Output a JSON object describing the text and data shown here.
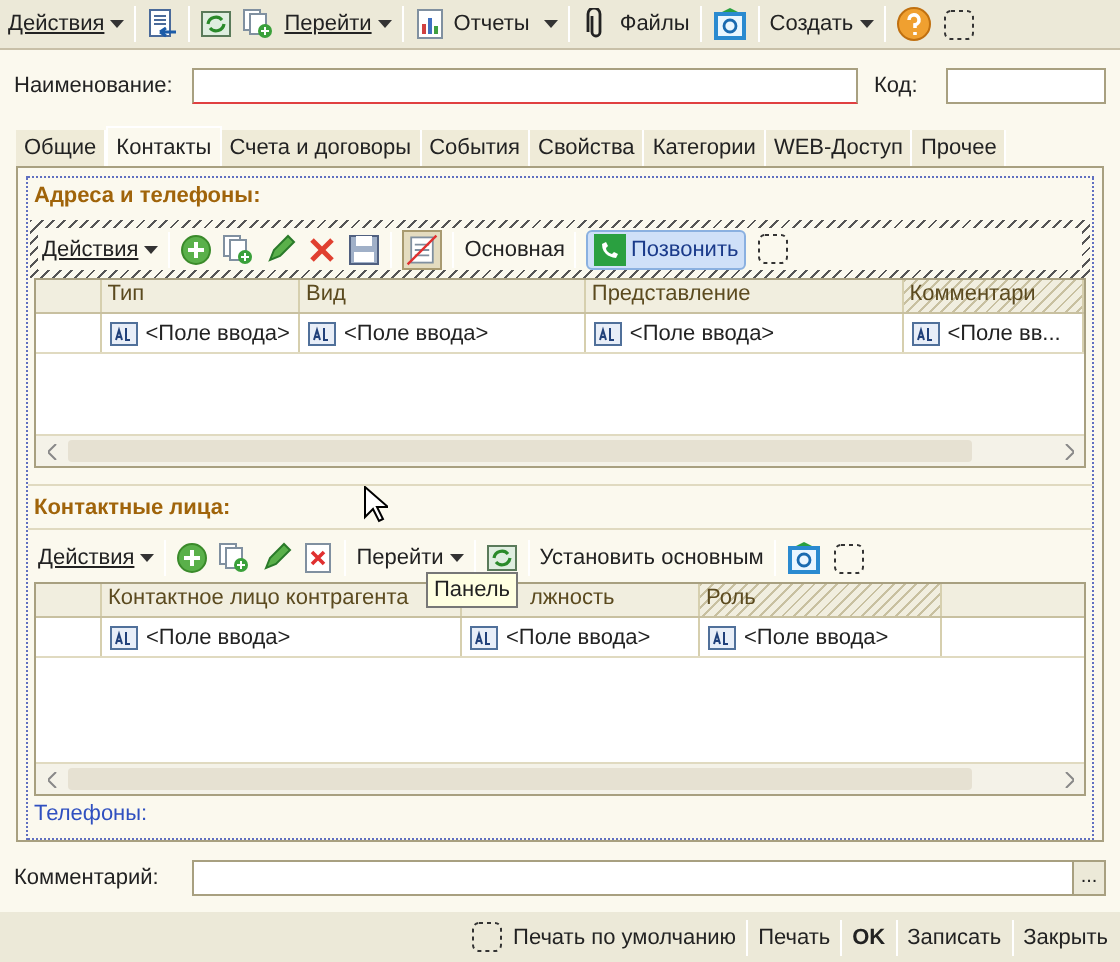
{
  "top_toolbar": [
    {
      "kind": "menu",
      "label": "Действия"
    },
    {
      "kind": "separator"
    },
    {
      "kind": "list"
    },
    {
      "kind": "separator"
    },
    {
      "kind": "refresh"
    },
    {
      "kind": "copy"
    },
    {
      "kind": "menu",
      "label": "Перейти"
    },
    {
      "kind": "separator"
    },
    {
      "kind": "report",
      "label": "Отчеты"
    },
    {
      "kind": "separator"
    },
    {
      "kind": "clip",
      "label": "Файлы"
    },
    {
      "kind": "separator"
    },
    {
      "kind": "email"
    },
    {
      "kind": "separator"
    },
    {
      "kind": "plain_menu",
      "label": "Создать"
    },
    {
      "kind": "separator"
    },
    {
      "kind": "help"
    },
    {
      "kind": "panel"
    }
  ],
  "name_field": {
    "label": "Наименование:"
  },
  "code_field": {
    "label": "Код:"
  },
  "tabs": [
    {
      "label": "Общие",
      "selected": false
    },
    {
      "label": "Контакты",
      "selected": true
    },
    {
      "label": "Счета и договоры",
      "selected": false
    },
    {
      "label": "События",
      "selected": false
    },
    {
      "label": "Свойства",
      "selected": false
    },
    {
      "label": "Категории",
      "selected": false
    },
    {
      "label": "WEB-Доступ",
      "selected": false
    },
    {
      "label": "Прочее",
      "selected": false
    }
  ],
  "addresses": {
    "title": "Адреса и телефоны:",
    "toolbar": [
      {
        "kind": "menu",
        "label": "Действия"
      },
      {
        "kind": "separator"
      },
      {
        "kind": "add"
      },
      {
        "kind": "copy"
      },
      {
        "kind": "edit"
      },
      {
        "kind": "delete"
      },
      {
        "kind": "save"
      },
      {
        "kind": "separator"
      },
      {
        "kind": "nolist"
      },
      {
        "kind": "separator"
      },
      {
        "kind": "text",
        "label": "Основная"
      },
      {
        "kind": "separator"
      },
      {
        "kind": "call",
        "label": "Позвонить"
      },
      {
        "kind": "panel"
      }
    ],
    "columns": [
      {
        "label": "Тип",
        "hatched": false
      },
      {
        "label": "Вид",
        "hatched": false
      },
      {
        "label": "Представление",
        "hatched": false
      },
      {
        "label": "Комментари",
        "hatched": true
      }
    ],
    "rows": [
      [
        "<Поле ввода>",
        "<Поле ввода>",
        "<Поле ввода>",
        "<Поле вв..."
      ]
    ]
  },
  "contacts": {
    "title": "Контактные лица:",
    "toolbar": [
      {
        "kind": "menu",
        "label": "Действия"
      },
      {
        "kind": "separator"
      },
      {
        "kind": "add"
      },
      {
        "kind": "copy"
      },
      {
        "kind": "edit"
      },
      {
        "kind": "delete_box"
      },
      {
        "kind": "separator"
      },
      {
        "kind": "plain_menu",
        "label": "Перейти"
      },
      {
        "kind": "separator"
      },
      {
        "kind": "refresh"
      },
      {
        "kind": "separator"
      },
      {
        "kind": "text",
        "label": "Установить основным"
      },
      {
        "kind": "separator"
      },
      {
        "kind": "email"
      },
      {
        "kind": "panel"
      }
    ],
    "columns": [
      {
        "label": "Контактное лицо контрагента",
        "hatched": false
      },
      {
        "label": "лжность",
        "hatched": false
      },
      {
        "label": "Роль",
        "hatched": true
      }
    ],
    "rows": [
      [
        "<Поле ввода>",
        "<Поле ввода>",
        "<Поле ввода>"
      ]
    ]
  },
  "tooltip": "Панель",
  "phones_label": "Телефоны:",
  "comment_field": {
    "label": "Комментарий:",
    "button": "..."
  },
  "bottom_bar": [
    {
      "kind": "panel"
    },
    {
      "kind": "text",
      "label": "Печать по умолчанию"
    },
    {
      "kind": "separator"
    },
    {
      "kind": "text",
      "label": "Печать"
    },
    {
      "kind": "separator"
    },
    {
      "kind": "bold",
      "label": "OK"
    },
    {
      "kind": "separator"
    },
    {
      "kind": "text",
      "label": "Записать"
    },
    {
      "kind": "separator"
    },
    {
      "kind": "text",
      "label": "Закрыть"
    }
  ]
}
